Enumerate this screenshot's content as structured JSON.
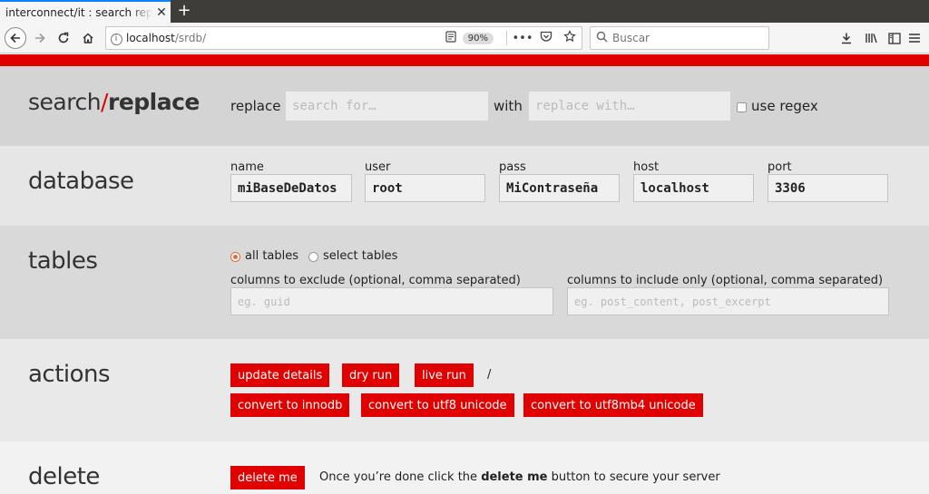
{
  "browser": {
    "tab_title": "interconnect/it : search replace d",
    "tab_close": "✕",
    "new_tab": "+",
    "url_host": "localhost",
    "url_path": "/srdb/",
    "zoom": "90%",
    "search_placeholder": "Buscar"
  },
  "brand": {
    "search": "search",
    "slash": "/",
    "replace": "replace"
  },
  "search": {
    "replace_label": "replace",
    "search_placeholder": "search for…",
    "with_label": "with",
    "replace_placeholder": "replace with…",
    "regex_label": "use regex"
  },
  "database": {
    "title": "database",
    "name_label": "name",
    "name_value": "miBaseDeDatos",
    "user_label": "user",
    "user_value": "root",
    "pass_label": "pass",
    "pass_value": "MiContraseña",
    "host_label": "host",
    "host_value": "localhost",
    "port_label": "port",
    "port_value": "3306"
  },
  "tables": {
    "title": "tables",
    "all_label": "all tables",
    "select_label": "select tables",
    "exclude_label": "columns to exclude (optional, comma separated)",
    "exclude_placeholder": "eg. guid",
    "include_label": "columns to include only (optional, comma separated)",
    "include_placeholder": "eg. post_content, post_excerpt"
  },
  "actions": {
    "title": "actions",
    "update": "update details",
    "dry": "dry run",
    "live": "live run",
    "sep": "/",
    "innodb": "convert to innodb",
    "utf8": "convert to utf8 unicode",
    "utf8mb4": "convert to utf8mb4 unicode"
  },
  "delete": {
    "title": "delete",
    "button": "delete me",
    "msg_before": "Once you’re done click the ",
    "msg_bold": "delete me",
    "msg_after": " button to secure your server"
  },
  "colors": {
    "accent": "#e00000",
    "radio_accent": "#e26b3b"
  },
  "icons": [
    "back-icon",
    "forward-icon",
    "reload-icon",
    "home-icon",
    "info-icon",
    "reader-icon",
    "more-icon",
    "pocket-icon",
    "bookmark-star-icon",
    "search-icon",
    "download-icon",
    "library-icon",
    "sidebar-icon",
    "menu-icon"
  ]
}
